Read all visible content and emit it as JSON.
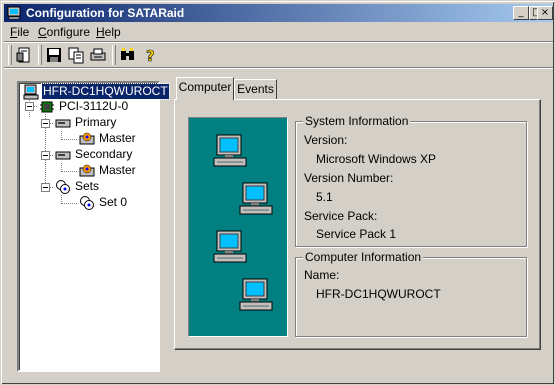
{
  "window": {
    "title": "Configuration for SATARaid"
  },
  "titlebar_buttons": {
    "minimize": "_",
    "maximize": "□",
    "close": "×"
  },
  "menu": [
    {
      "label": "File",
      "accel": "F"
    },
    {
      "label": "Configure",
      "accel": "C"
    },
    {
      "label": "Help",
      "accel": "H"
    }
  ],
  "toolbar": {
    "icons": [
      "properties-icon",
      "save-icon",
      "copy-icon",
      "print-icon",
      "find-icon",
      "help-icon"
    ]
  },
  "tree": {
    "root": "HFR-DC1HQWUROCT",
    "controller": "PCI-3112U-0",
    "primary": "Primary",
    "primary_master": "Master",
    "secondary": "Secondary",
    "secondary_master": "Master",
    "sets": "Sets",
    "set0": "Set 0"
  },
  "tabs": [
    {
      "label": "Computer",
      "active": true
    },
    {
      "label": "Events",
      "active": false
    }
  ],
  "system_info": {
    "title": "System Information",
    "version_label": "Version:",
    "version_value": "Microsoft Windows XP",
    "version_number_label": "Version Number:",
    "version_number_value": "5.1",
    "service_pack_label": "Service Pack:",
    "service_pack_value": "Service Pack 1"
  },
  "computer_info": {
    "title": "Computer Information",
    "name_label": "Name:",
    "name_value": "HFR-DC1HQWUROCT"
  },
  "colors": {
    "title_start": "#0a246a",
    "title_end": "#a6caf0",
    "panel_bg": "#008080",
    "face": "#d4d0c8"
  }
}
